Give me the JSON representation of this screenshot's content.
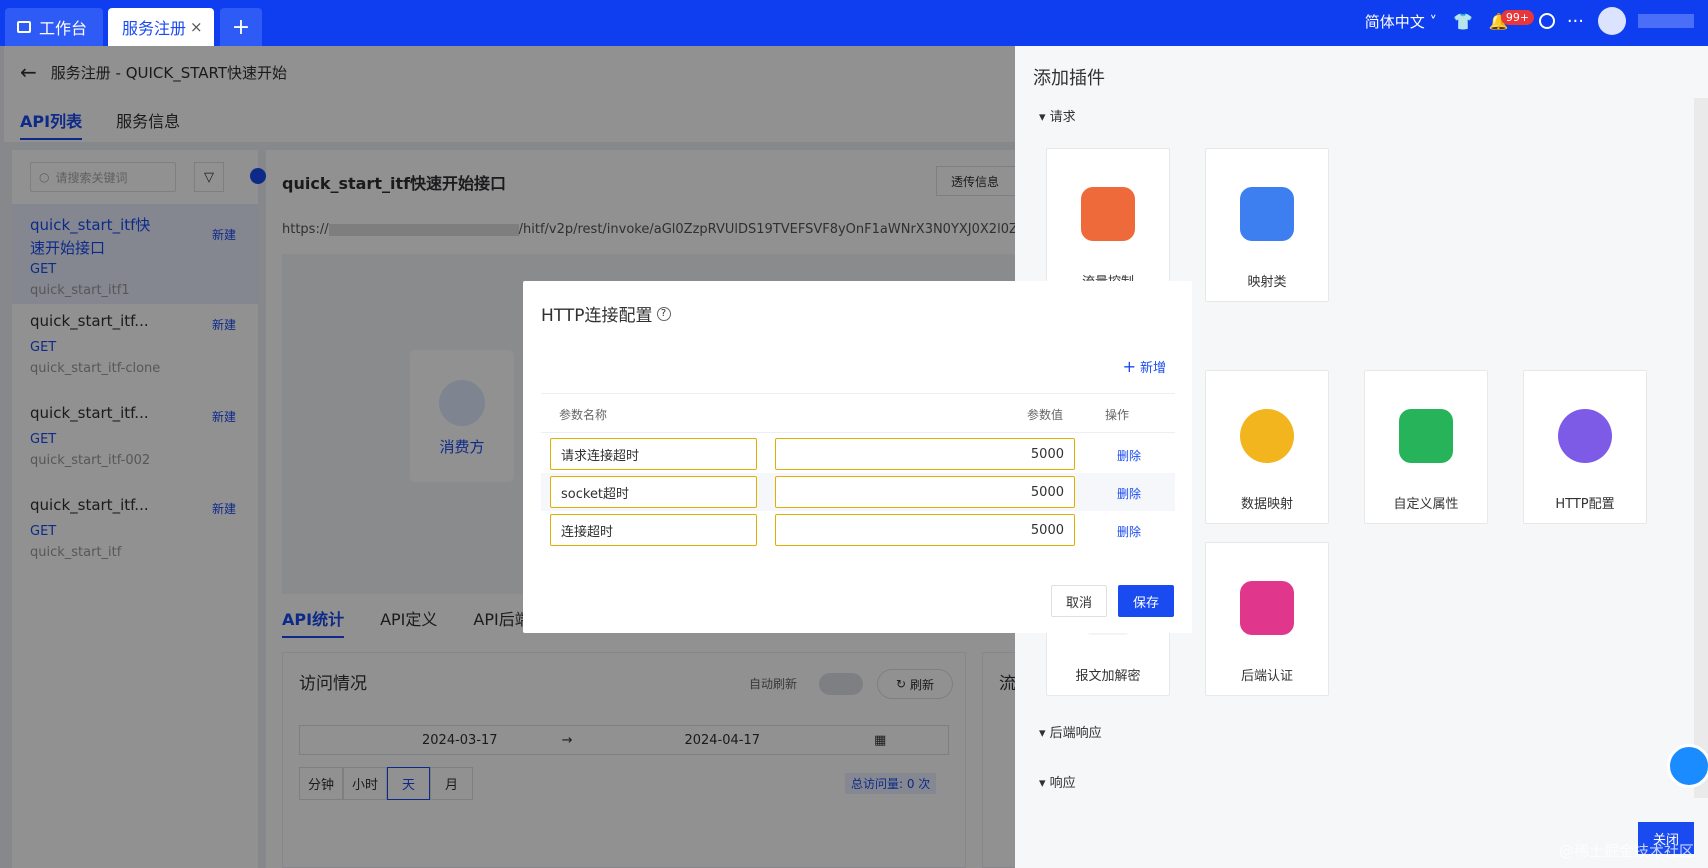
{
  "topbar": {
    "tabs": [
      "工作台",
      "服务注册"
    ],
    "close": "×",
    "add": "+",
    "lang": "简体中文",
    "badge": "99+"
  },
  "header": {
    "back": "←",
    "title": "服务注册 - QUICK_START快速开始"
  },
  "page_tabs": [
    "API列表",
    "服务信息"
  ],
  "search": {
    "placeholder": "请搜索关键词"
  },
  "api_list": [
    {
      "name1": "quick_start_itf快",
      "name2": "速开始接口",
      "method": "GET",
      "id": "quick_start_itf1",
      "tag": "新建"
    },
    {
      "name1": "quick_start_itf...",
      "method": "GET",
      "id": "quick_start_itf-clone",
      "tag": "新建"
    },
    {
      "name1": "quick_start_itf...",
      "method": "GET",
      "id": "quick_start_itf-002",
      "tag": "新建"
    },
    {
      "name1": "quick_start_itf...",
      "method": "GET",
      "id": "quick_start_itf",
      "tag": "新建"
    }
  ],
  "detail": {
    "title": "quick_start_itf快速开始接口",
    "url": "https://",
    "url_tail": "/hitf/v2p/rest/invoke/aGl0ZzpRVUlDS19TVEFSVF8yOnF1aWNrX3N0YXJ0X2l0Z",
    "trans_btn": "透传信息",
    "consumer": "消费方"
  },
  "stats_tabs": [
    "API统计",
    "API定义",
    "API后端"
  ],
  "visits": {
    "title": "访问情况",
    "auto_refresh": "自动刷新",
    "refresh": "刷新",
    "date_from": "2024-03-17",
    "arrow": "→",
    "date_to": "2024-04-17",
    "units": [
      "分钟",
      "小时",
      "天",
      "月"
    ],
    "total": "总访问量: 0 次",
    "flow": "流"
  },
  "modal": {
    "title": "HTTP连接配置",
    "add": "新增",
    "col_name": "参数名称",
    "col_value": "参数值",
    "col_op": "操作",
    "rows": [
      {
        "name": "请求连接超时",
        "value": "5000",
        "op": "删除"
      },
      {
        "name": "socket超时",
        "value": "5000",
        "op": "删除"
      },
      {
        "name": "连接超时",
        "value": "5000",
        "op": "删除"
      }
    ],
    "cancel": "取消",
    "save": "保存"
  },
  "plugins": {
    "title": "添加插件",
    "sections": [
      "请求",
      "后端响应",
      "响应"
    ],
    "cards": [
      "流量控制",
      "映射类",
      "数据映射",
      "自定义属性",
      "HTTP配置",
      "报文加解密",
      "后端认证"
    ],
    "close": "关闭"
  },
  "watermark": "@稀土掘金技术社区",
  "colors": {
    "primary": "#0f3ef0",
    "warning_border": "#e0b000"
  }
}
